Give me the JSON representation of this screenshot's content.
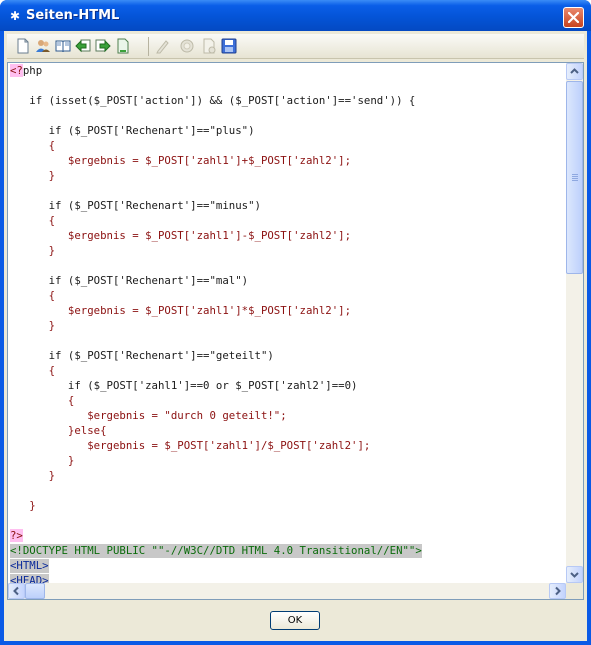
{
  "window": {
    "title": "Seiten-HTML"
  },
  "toolbar": {
    "buttons": [
      {
        "icon": "new-page-icon"
      },
      {
        "icon": "users-icon"
      },
      {
        "icon": "book-icon"
      },
      {
        "icon": "back-arrow-icon"
      },
      {
        "icon": "forward-arrow-icon"
      },
      {
        "icon": "page-icon"
      },
      {
        "icon": "pen-icon",
        "disabled": true
      },
      {
        "icon": "refresh-icon",
        "disabled": true
      },
      {
        "icon": "edit-page-icon",
        "disabled": true
      },
      {
        "icon": "save-icon"
      }
    ]
  },
  "editor": {
    "lines": [
      {
        "segments": [
          {
            "t": "<?",
            "k": "php"
          },
          {
            "t": "php",
            "k": "kw"
          }
        ]
      },
      {
        "segments": []
      },
      {
        "segments": [
          {
            "t": "   if (isset($_POST['action']) && ($_POST['action']=='send')) {",
            "k": "kw"
          }
        ]
      },
      {
        "segments": []
      },
      {
        "segments": [
          {
            "t": "      if ($_POST['Rechenart']==\"plus\")",
            "k": "kw"
          }
        ]
      },
      {
        "segments": [
          {
            "t": "      {",
            "k": "str"
          }
        ]
      },
      {
        "segments": [
          {
            "t": "         $ergebnis = $_POST['zahl1']+$_POST['zahl2'];",
            "k": "str"
          }
        ]
      },
      {
        "segments": [
          {
            "t": "      }",
            "k": "str"
          }
        ]
      },
      {
        "segments": []
      },
      {
        "segments": [
          {
            "t": "      if ($_POST['Rechenart']==\"minus\")",
            "k": "kw"
          }
        ]
      },
      {
        "segments": [
          {
            "t": "      {",
            "k": "str"
          }
        ]
      },
      {
        "segments": [
          {
            "t": "         $ergebnis = $_POST['zahl1']-$_POST['zahl2'];",
            "k": "str"
          }
        ]
      },
      {
        "segments": [
          {
            "t": "      }",
            "k": "str"
          }
        ]
      },
      {
        "segments": []
      },
      {
        "segments": [
          {
            "t": "      if ($_POST['Rechenart']==\"mal\")",
            "k": "kw"
          }
        ]
      },
      {
        "segments": [
          {
            "t": "      {",
            "k": "str"
          }
        ]
      },
      {
        "segments": [
          {
            "t": "         $ergebnis = $_POST['zahl1']*$_POST['zahl2'];",
            "k": "str"
          }
        ]
      },
      {
        "segments": [
          {
            "t": "      }",
            "k": "str"
          }
        ]
      },
      {
        "segments": []
      },
      {
        "segments": [
          {
            "t": "      if ($_POST['Rechenart']==\"geteilt\")",
            "k": "kw"
          }
        ]
      },
      {
        "segments": [
          {
            "t": "      {",
            "k": "str"
          }
        ]
      },
      {
        "segments": [
          {
            "t": "         if ($_POST['zahl1']==0 or $_POST['zahl2']==0)",
            "k": "kw"
          }
        ]
      },
      {
        "segments": [
          {
            "t": "         {",
            "k": "str"
          }
        ]
      },
      {
        "segments": [
          {
            "t": "            $ergebnis = \"durch 0 geteilt!\";",
            "k": "str"
          }
        ]
      },
      {
        "segments": [
          {
            "t": "         }else{",
            "k": "str"
          }
        ]
      },
      {
        "segments": [
          {
            "t": "            $ergebnis = $_POST['zahl1']/$_POST['zahl2'];",
            "k": "str"
          }
        ]
      },
      {
        "segments": [
          {
            "t": "         }",
            "k": "str"
          }
        ]
      },
      {
        "segments": [
          {
            "t": "      }",
            "k": "str"
          }
        ]
      },
      {
        "segments": []
      },
      {
        "segments": [
          {
            "t": "   }",
            "k": "str"
          }
        ]
      },
      {
        "segments": []
      },
      {
        "segments": [
          {
            "t": "?>",
            "k": "php"
          }
        ]
      },
      {
        "segments": [
          {
            "t": "<!DOCTYPE HTML PUBLIC \"\"-//W3C//DTD HTML 4.0 Transitional//EN\"\">",
            "k": "dt"
          }
        ],
        "highlight": true
      },
      {
        "segments": [
          {
            "t": "<HTML>",
            "k": "tag"
          }
        ],
        "highlight": true
      },
      {
        "segments": [
          {
            "t": "<HEAD>",
            "k": "tag"
          }
        ],
        "highlight": true
      }
    ]
  },
  "footer": {
    "ok_label": "OK"
  }
}
